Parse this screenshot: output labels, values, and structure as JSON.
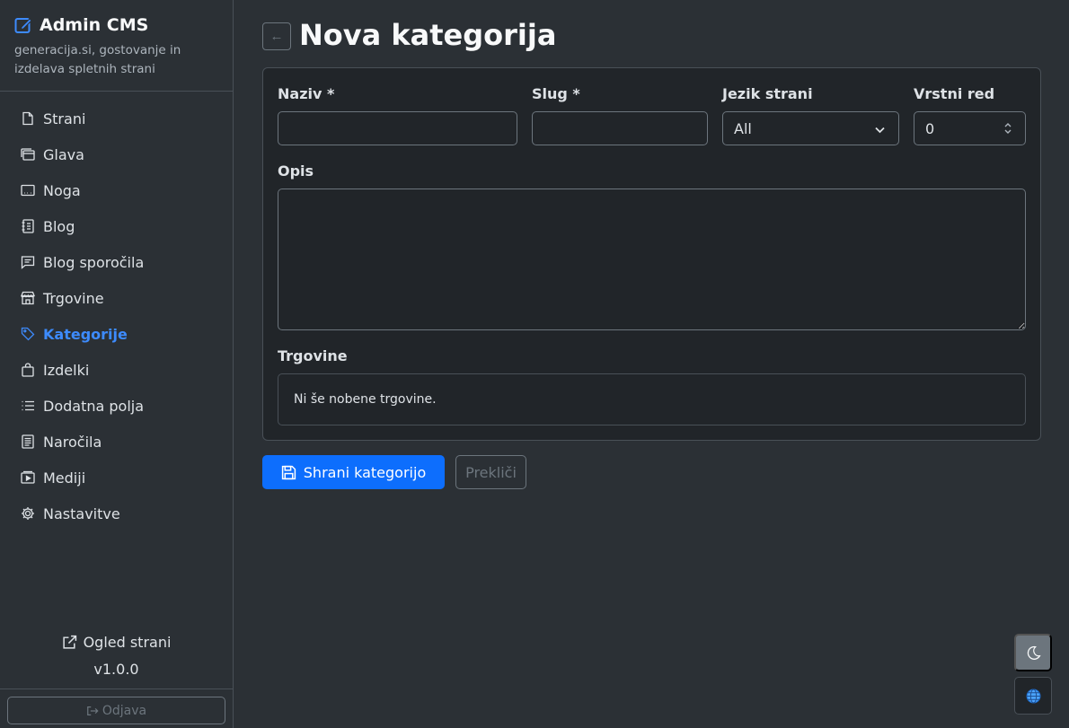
{
  "brand": {
    "title": "Admin CMS",
    "subtitle": "generacija.si, gostovanje in izdelava spletnih strani"
  },
  "sidebar": {
    "items": [
      {
        "label": "Strani",
        "icon": "file-icon"
      },
      {
        "label": "Glava",
        "icon": "window-stack-icon"
      },
      {
        "label": "Noga",
        "icon": "window-dots-icon"
      },
      {
        "label": "Blog",
        "icon": "journal-icon"
      },
      {
        "label": "Blog sporočila",
        "icon": "chat-icon"
      },
      {
        "label": "Trgovine",
        "icon": "shop-icon"
      },
      {
        "label": "Kategorije",
        "icon": "tag-icon",
        "active": true
      },
      {
        "label": "Izdelki",
        "icon": "bag-icon"
      },
      {
        "label": "Dodatna polja",
        "icon": "list-icon"
      },
      {
        "label": "Naročila",
        "icon": "receipt-icon"
      },
      {
        "label": "Mediji",
        "icon": "play-icon"
      },
      {
        "label": "Nastavitve",
        "icon": "gear-icon"
      }
    ],
    "preview_label": "Ogled strani",
    "version": "v1.0.0",
    "logout_label": "Odjava"
  },
  "page": {
    "back_symbol": "←",
    "title": "Nova kategorija"
  },
  "form": {
    "name_label": "Naziv *",
    "name_value": "",
    "slug_label": "Slug *",
    "slug_value": "",
    "language_label": "Jezik strani",
    "language_value": "All",
    "order_label": "Vrstni red",
    "order_value": "0",
    "description_label": "Opis",
    "description_value": "",
    "stores_label": "Trgovine",
    "stores_empty": "Ni še nobene trgovine."
  },
  "actions": {
    "save_label": "Shrani kategorijo",
    "cancel_label": "Prekliči"
  },
  "colors": {
    "accent": "#0d6efd",
    "active_nav": "#3d8bfd",
    "background": "#2b3035",
    "card": "#212529"
  }
}
